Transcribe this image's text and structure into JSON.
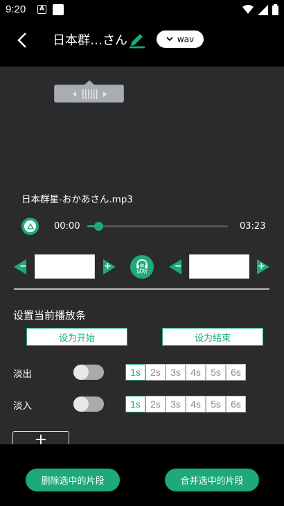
{
  "status_bar": {
    "time": "9:20"
  },
  "header": {
    "title": "日本群…さん",
    "format": "wav"
  },
  "editor": {
    "file_name": "日本群星-おかあさん.mp3",
    "current_time": "00:00",
    "total_time": "03:23",
    "progress": 0.08,
    "preview_label": "试听",
    "start_time_value": "",
    "end_time_value": ""
  },
  "playbar_section": {
    "title": "设置当前播放条",
    "set_start_label": "设为开始",
    "set_end_label": "设为结束"
  },
  "fade_out": {
    "label": "淡出",
    "enabled": false,
    "options": [
      "1s",
      "2s",
      "3s",
      "4s",
      "5s",
      "6s"
    ],
    "selected": "1s"
  },
  "fade_in": {
    "label": "淡入",
    "enabled": false,
    "options": [
      "1s",
      "2s",
      "3s",
      "4s",
      "5s",
      "6s"
    ],
    "selected": "1s"
  },
  "add_button": {
    "label": "+"
  },
  "bottom": {
    "delete_label": "删除选中的片段",
    "merge_label": "合并选中的片段"
  },
  "colors": {
    "accent": "#1ea97c",
    "panel": "#2b2b2d"
  }
}
